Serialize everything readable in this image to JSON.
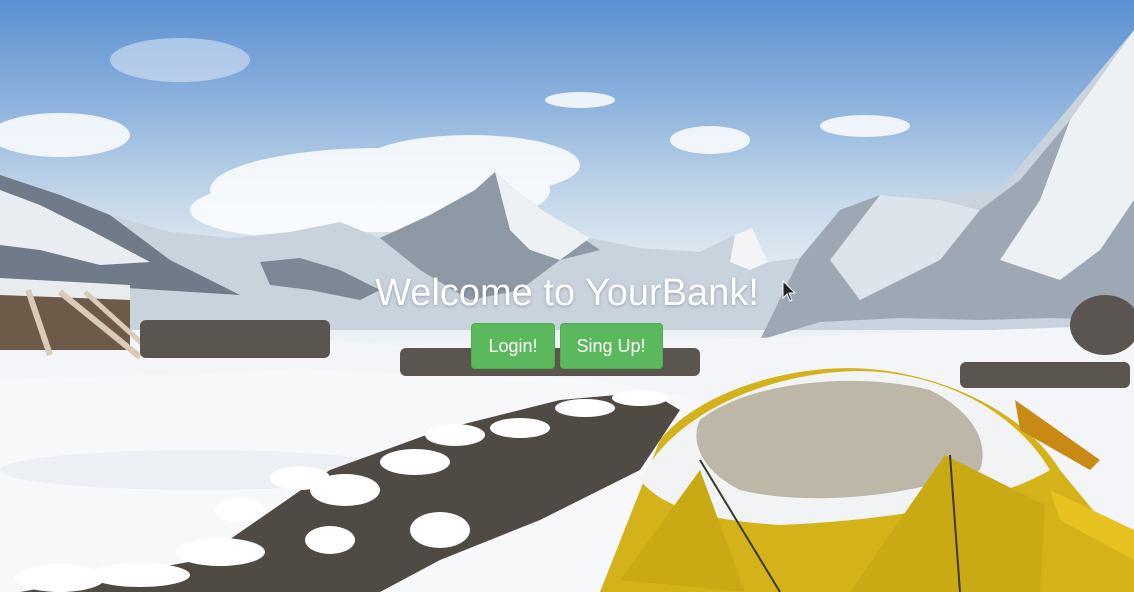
{
  "hero": {
    "title": "Welcome to YourBank!",
    "background": "snowy-mountain-camp-photo"
  },
  "actions": {
    "login_label": "Login!",
    "signup_label": "Sing Up!"
  },
  "colors": {
    "button": "#5cb85c",
    "button_border": "#4cae4c",
    "title_text": "#ffffff",
    "tent_yellow": "#d4b31a"
  }
}
